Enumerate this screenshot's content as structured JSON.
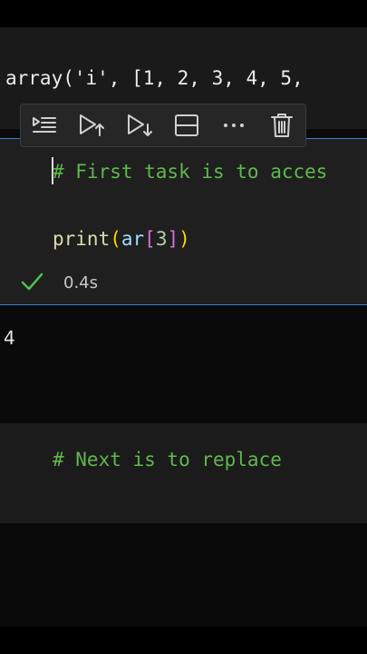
{
  "output_prev": {
    "text": "array('i', [1, 2, 3, 4, 5,"
  },
  "cell": {
    "comment": "# First task is to acces",
    "code": {
      "fn": "print",
      "open1": "(",
      "var": "ar",
      "open2": "[",
      "index": "3",
      "close2": "]",
      "close1": ")"
    },
    "status_icon": "check-icon",
    "exec_time": "0.4s"
  },
  "toolbar": {
    "buttons": [
      {
        "name": "execute-above-cells",
        "icon": "run-above-icon"
      },
      {
        "name": "execute-cell-and-above",
        "icon": "run-up-icon"
      },
      {
        "name": "execute-cell-and-below",
        "icon": "run-down-icon"
      },
      {
        "name": "split-cell",
        "icon": "split-cell-icon"
      },
      {
        "name": "more-actions",
        "icon": "ellipsis-icon"
      },
      {
        "name": "delete-cell",
        "icon": "trash-icon"
      }
    ]
  },
  "output": {
    "value": "4"
  },
  "markdown_cell": {
    "text": "# Next is to replace"
  },
  "colors": {
    "accent": "#3a7fd0",
    "comment": "#5fb84d",
    "check": "#4fbf4f"
  }
}
